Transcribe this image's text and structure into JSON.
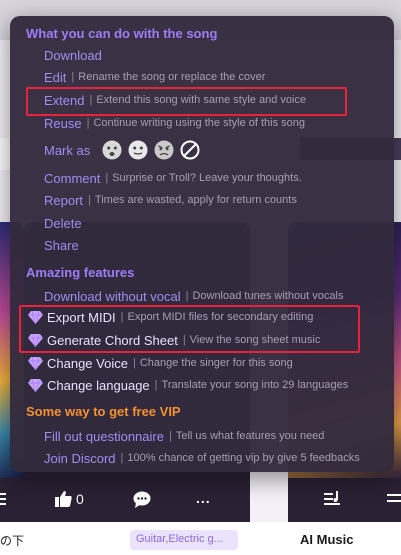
{
  "background": {
    "actions": {
      "like_count": "0",
      "more": "..."
    },
    "card_left_title": "の下",
    "genre_tag": "Guitar,Electric g...",
    "card_right_title": "AI Music"
  },
  "menu": {
    "section_song": "What you can do with the song",
    "download": "Download",
    "edit": {
      "label": "Edit",
      "desc": "Rename the song or replace the cover"
    },
    "extend": {
      "label": "Extend",
      "desc": "Extend this song with same style and voice"
    },
    "reuse": {
      "label": "Reuse",
      "desc": "Continue writing using the style of this song"
    },
    "mark_as": "Mark as",
    "comment": {
      "label": "Comment",
      "desc": "Surprise or Troll? Leave your thoughts."
    },
    "report": {
      "label": "Report",
      "desc": "Times are wasted, apply for return counts"
    },
    "delete": "Delete",
    "share": "Share",
    "section_features": "Amazing features",
    "download_no_vocal": {
      "label": "Download without vocal",
      "desc": "Download tunes without vocals"
    },
    "export_midi": {
      "label": "Export MIDI",
      "desc": "Export MIDI files for secondary editing"
    },
    "chord_sheet": {
      "label": "Generate Chord Sheet",
      "desc": "View the song sheet music"
    },
    "change_voice": {
      "label": "Change Voice",
      "desc": "Change the singer for this song"
    },
    "change_language": {
      "label": "Change language",
      "desc": "Translate your song into 29 languages"
    },
    "section_vip": "Some way to get free VIP",
    "questionnaire": {
      "label": "Fill out questionnaire",
      "desc": "Tell us what features you need"
    },
    "discord": {
      "label": "Join Discord",
      "desc": "100% chance of getting vip by give 5 feedbacks"
    },
    "separator": "|"
  },
  "colors": {
    "accent": "#a07cf5",
    "vip": "#f4912f",
    "highlight": "#e8223a",
    "menu_bg": "#322a3c"
  }
}
